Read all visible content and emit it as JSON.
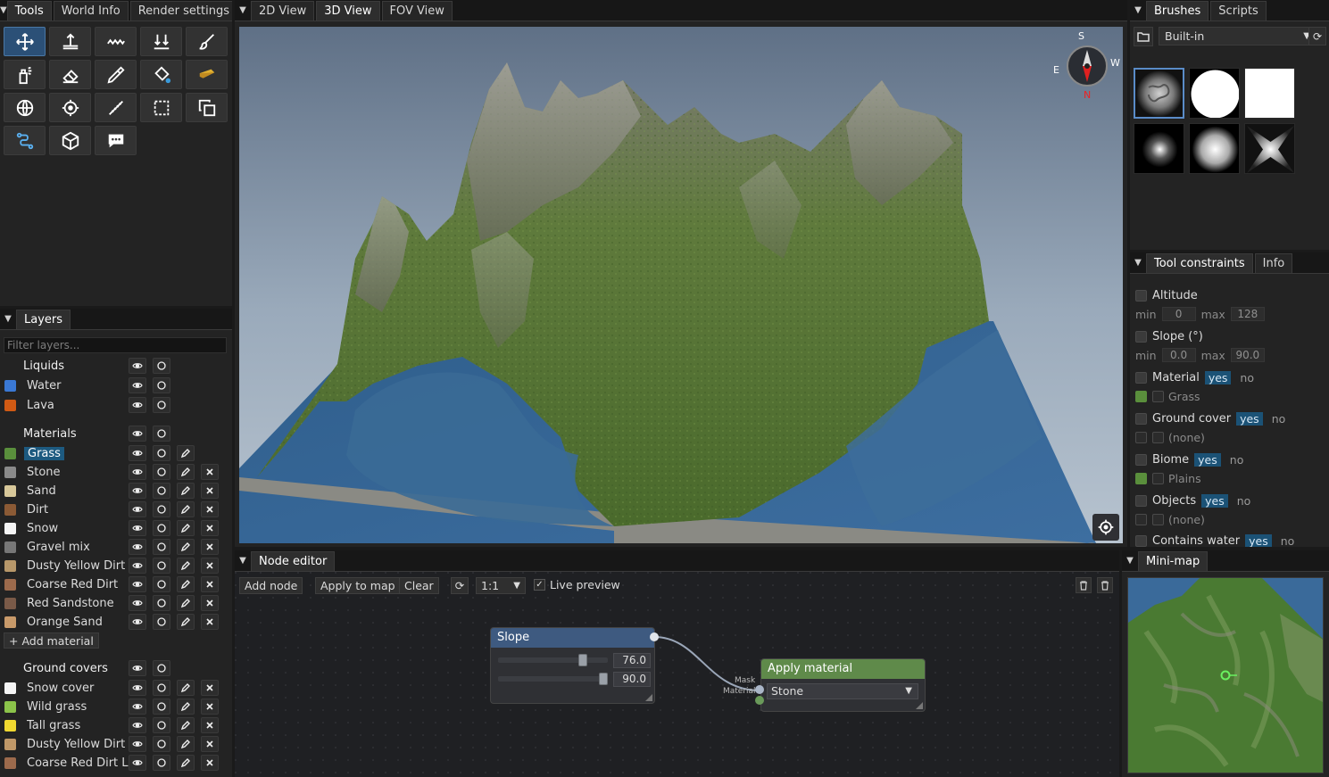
{
  "tools_panel": {
    "tabs": [
      "Tools",
      "World Info",
      "Render settings"
    ],
    "buttons": [
      {
        "icon": "move-icon",
        "active": true
      },
      {
        "icon": "raise-icon"
      },
      {
        "icon": "smooth-icon"
      },
      {
        "icon": "lower-icon"
      },
      {
        "icon": "paint-brush-icon"
      },
      {
        "icon": "spray-icon"
      },
      {
        "icon": "eraser-icon"
      },
      {
        "icon": "eyedropper-icon"
      },
      {
        "icon": "fill-bucket-icon"
      },
      {
        "icon": "sponge-icon"
      },
      {
        "icon": "globe-icon"
      },
      {
        "icon": "target-icon"
      },
      {
        "icon": "ruler-icon"
      },
      {
        "icon": "select-rect-icon"
      },
      {
        "icon": "copy-icon"
      },
      {
        "icon": "path-icon"
      },
      {
        "icon": "cube-icon"
      },
      {
        "icon": "comment-icon"
      }
    ]
  },
  "view_tabs": [
    "2D View",
    "3D View",
    "FOV View"
  ],
  "layers": {
    "tab": "Layers",
    "filter_placeholder": "Filter layers...",
    "groups": {
      "liquids": "Liquids",
      "materials": "Materials",
      "ground_covers": "Ground covers"
    },
    "liquids": [
      {
        "name": "Water",
        "color": "#3a78d4"
      },
      {
        "name": "Lava",
        "color": "#d05a14"
      }
    ],
    "materials": [
      {
        "name": "Grass",
        "color": "#5a8f3c",
        "selected": true
      },
      {
        "name": "Stone",
        "color": "#8a8a8a"
      },
      {
        "name": "Sand",
        "color": "#d8c89a"
      },
      {
        "name": "Dirt",
        "color": "#8b5a35"
      },
      {
        "name": "Snow",
        "color": "#f4f4f4"
      },
      {
        "name": "Gravel mix",
        "color": "#777777"
      },
      {
        "name": "Dusty Yellow Dirt",
        "color": "#b8986a"
      },
      {
        "name": "Coarse Red Dirt",
        "color": "#9c6a4c"
      },
      {
        "name": "Red Sandstone",
        "color": "#7a5a48"
      },
      {
        "name": "Orange Sand",
        "color": "#c89a6a"
      }
    ],
    "add_material": "+ Add material",
    "ground_covers": [
      {
        "name": "Snow cover",
        "color": "#f4f4f4"
      },
      {
        "name": "Wild grass",
        "color": "#8bc34a"
      },
      {
        "name": "Tall grass",
        "color": "#f0d830"
      },
      {
        "name": "Dusty Yellow Dirt La",
        "color": "#c09868"
      },
      {
        "name": "Coarse Red Dirt Laye",
        "color": "#9c6a4c"
      }
    ]
  },
  "compass": {
    "n": "N",
    "s": "S",
    "e": "E",
    "w": "W"
  },
  "brushes": {
    "tabs": [
      "Brushes",
      "Scripts"
    ],
    "source": "Built-in"
  },
  "constraints": {
    "tabs": [
      "Tool constraints",
      "Info"
    ],
    "altitude": {
      "label": "Altitude",
      "min_label": "min",
      "min": "0",
      "max_label": "max",
      "max": "128"
    },
    "slope": {
      "label": "Slope (°)",
      "min_label": "min",
      "min": "0.0",
      "max_label": "max",
      "max": "90.0"
    },
    "yes": "yes",
    "no": "no",
    "material": {
      "label": "Material",
      "value": "Grass",
      "color": "#5a8f3c"
    },
    "ground_cover": {
      "label": "Ground cover",
      "value": "(none)"
    },
    "biome": {
      "label": "Biome",
      "value": "Plains",
      "color": "#5a8f3c"
    },
    "objects": {
      "label": "Objects",
      "value": "(none)"
    },
    "contains_water": {
      "label": "Contains water"
    }
  },
  "node_editor": {
    "tab": "Node editor",
    "add_node": "Add node",
    "apply_to_map": "Apply to map",
    "clear": "Clear",
    "zoom": "1:1",
    "live_preview": "Live preview",
    "slope_node": {
      "title": "Slope",
      "value1": "76.0",
      "value1_fraction": 0.8,
      "value2": "90.0",
      "value2_fraction": 1.0
    },
    "apply_node": {
      "title": "Apply material",
      "mask_label": "Mask",
      "material_label": "Material",
      "material": "Stone"
    }
  },
  "minimap": {
    "tab": "Mini-map"
  }
}
